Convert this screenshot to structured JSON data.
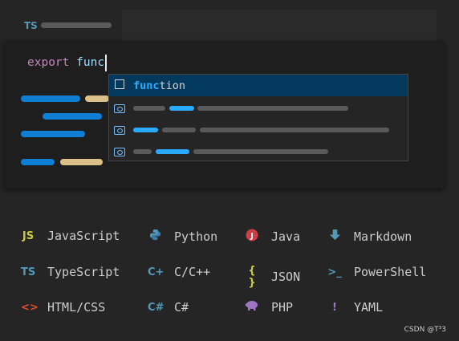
{
  "tab": {
    "badge": "TS"
  },
  "editor": {
    "keyword": "export",
    "typed": "func",
    "suggestion": {
      "match": "func",
      "rest": "tion"
    }
  },
  "languages": [
    {
      "name": "JavaScript",
      "icon": "javascript-icon",
      "glyph": "JS",
      "color": "#cbcb41"
    },
    {
      "name": "Python",
      "icon": "python-icon",
      "glyph": "",
      "color": "#519aba"
    },
    {
      "name": "Java",
      "icon": "java-icon",
      "glyph": "J",
      "color": "#cc3e44"
    },
    {
      "name": "Markdown",
      "icon": "markdown-icon",
      "glyph": "",
      "color": "#519aba"
    },
    {
      "name": "TypeScript",
      "icon": "typescript-icon",
      "glyph": "TS",
      "color": "#519aba"
    },
    {
      "name": "C/C++",
      "icon": "cpp-icon",
      "glyph": "C+",
      "color": "#519aba"
    },
    {
      "name": "JSON",
      "icon": "json-icon",
      "glyph": "{ }",
      "color": "#cbcb41"
    },
    {
      "name": "PowerShell",
      "icon": "powershell-icon",
      "glyph": ">_",
      "color": "#519aba"
    },
    {
      "name": "HTML/CSS",
      "icon": "html-icon",
      "glyph": "<>",
      "color": "#e44d26"
    },
    {
      "name": "C#",
      "icon": "csharp-icon",
      "glyph": "C#",
      "color": "#519aba"
    },
    {
      "name": "PHP",
      "icon": "php-icon",
      "glyph": "",
      "color": "#a074c4"
    },
    {
      "name": "YAML",
      "icon": "yaml-icon",
      "glyph": "!",
      "color": "#a074c4"
    }
  ],
  "watermark": "CSDN @T³3"
}
